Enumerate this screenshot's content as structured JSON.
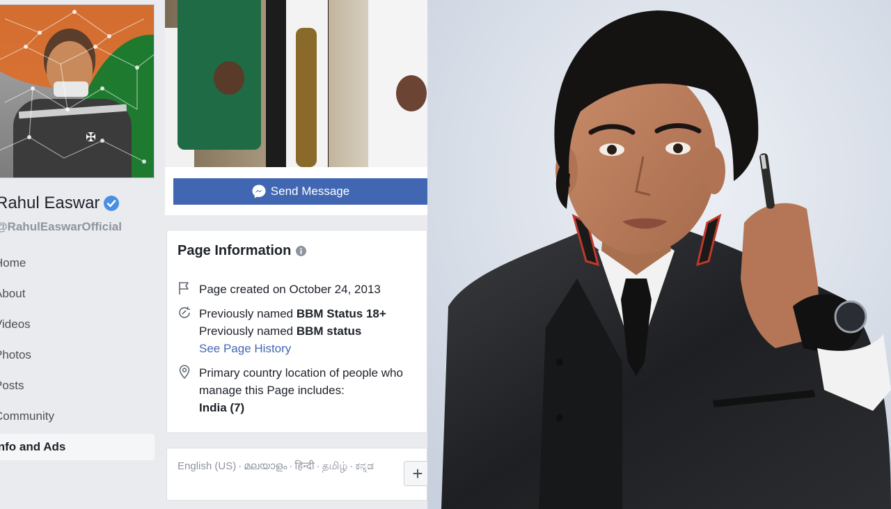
{
  "profile": {
    "name": "Rahul Easwar",
    "handle": "@RahulEaswarOfficial"
  },
  "nav": {
    "items": [
      {
        "label": "Home"
      },
      {
        "label": "About"
      },
      {
        "label": "Videos"
      },
      {
        "label": "Photos"
      },
      {
        "label": "Posts"
      },
      {
        "label": "Community"
      },
      {
        "label": "Info and Ads"
      }
    ],
    "active_index": 6
  },
  "actions": {
    "send_message_label": "Send Message"
  },
  "page_info": {
    "title": "Page Information",
    "created": "Page created on October 24, 2013",
    "prev_name_prefix": "Previously named",
    "prev_names": [
      "BBM Status 18+",
      "BBM status"
    ],
    "history_link": "See Page History",
    "location_text": "Primary country location of people who manage this Page includes:",
    "location_country": "India (7)"
  },
  "languages": {
    "items": [
      "English (US)",
      "മലയാളം",
      "हिन्दी",
      "தமிழ்",
      "ಕನ್ನಡ"
    ],
    "separator": "·",
    "add_label": "+"
  },
  "colors": {
    "facebook_blue": "#4267b2",
    "verified_blue": "#4a90e2",
    "page_bg": "#e9ebee"
  },
  "icons": {
    "verified": "verified-badge-icon",
    "messenger": "messenger-icon",
    "info": "info-icon",
    "flag": "flag-icon",
    "history": "history-icon",
    "location": "location-pin-icon",
    "add": "plus-icon"
  }
}
